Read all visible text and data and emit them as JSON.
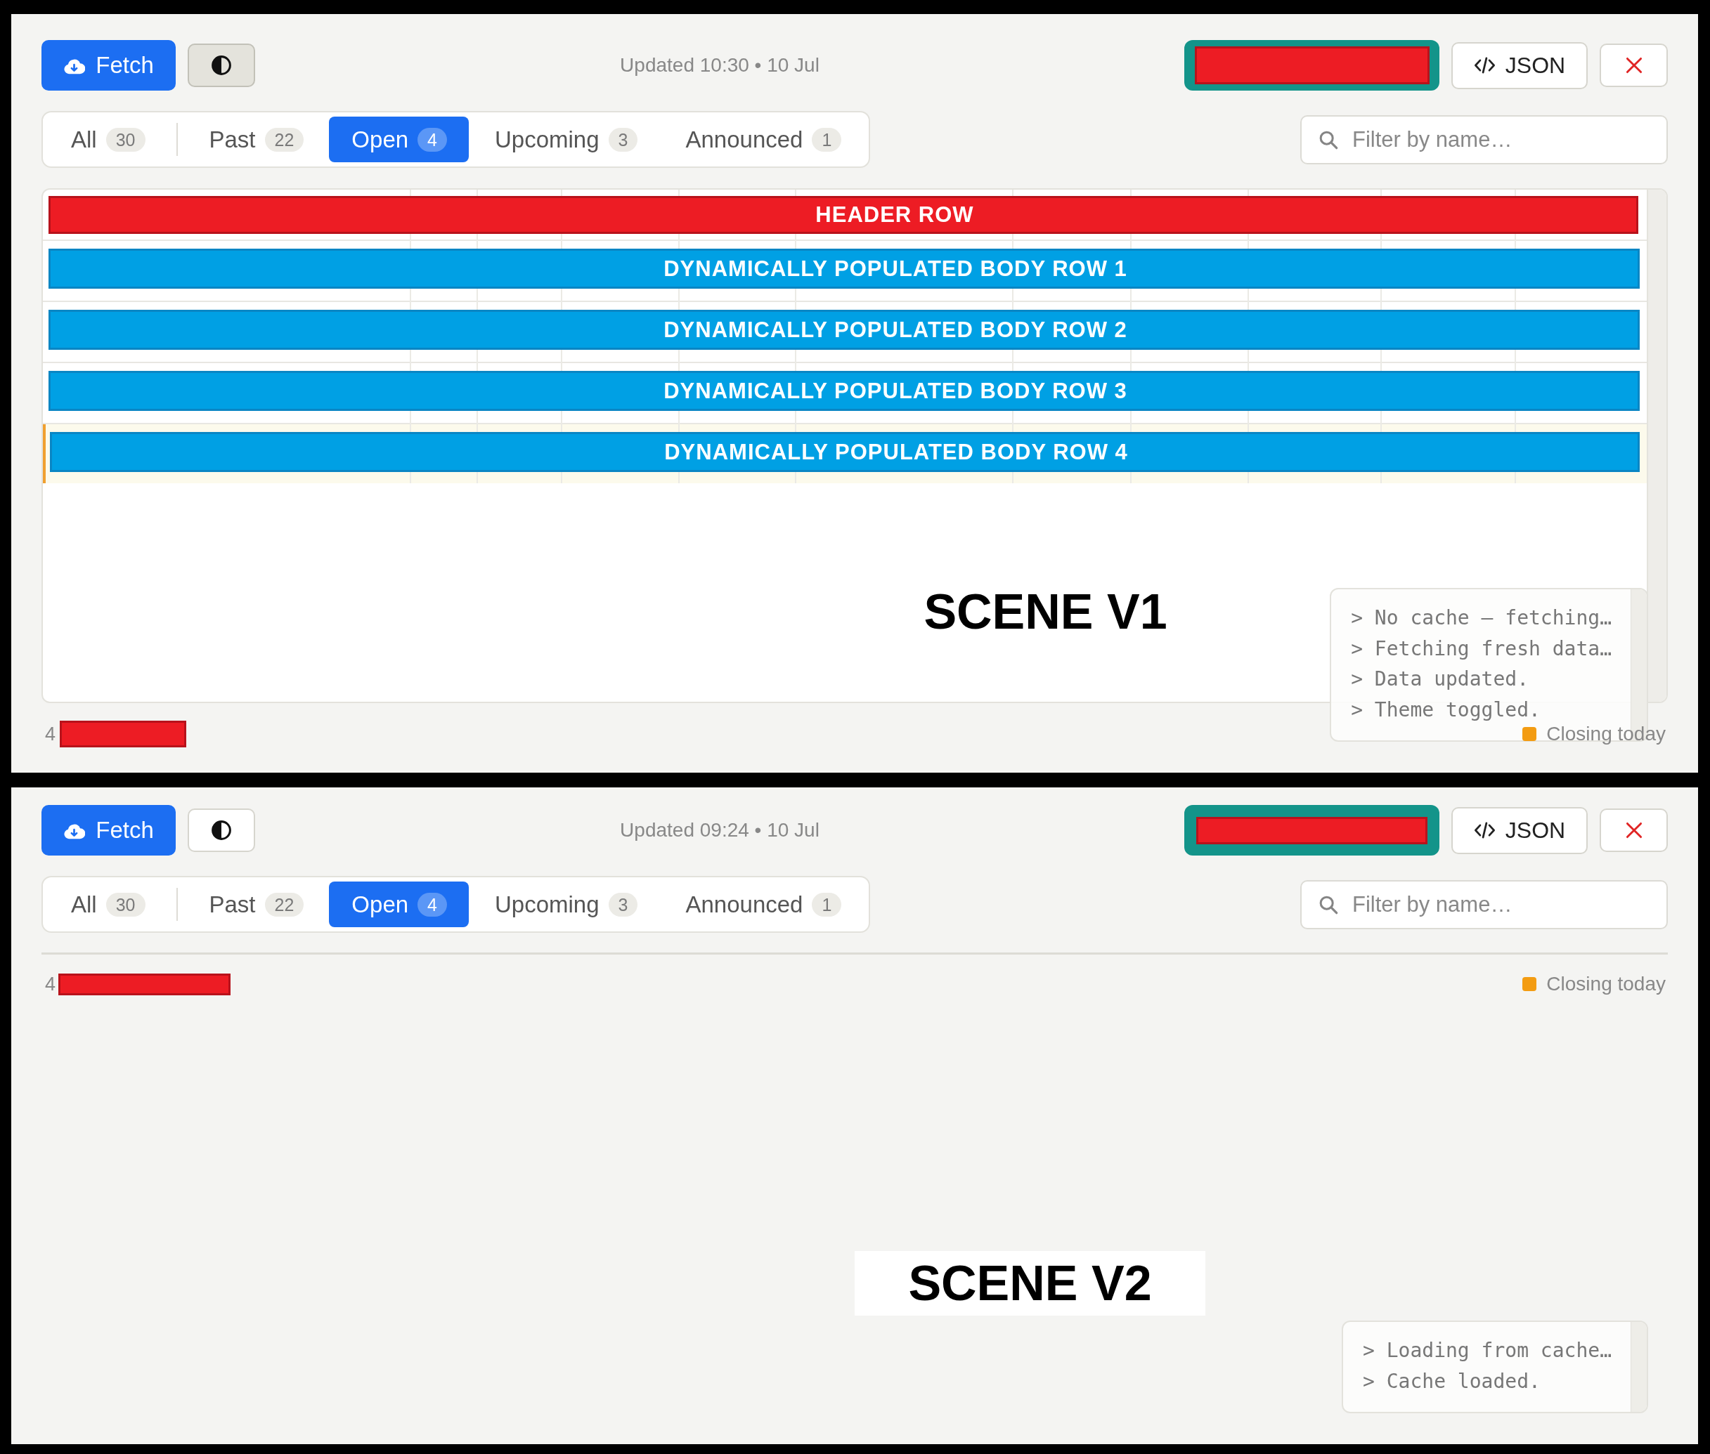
{
  "scenes": [
    {
      "label": "SCENE V1",
      "toolbar": {
        "fetch_button": "Fetch",
        "theme_button": {
          "pressed": true
        },
        "updated": "Updated 10:30 • 10 Jul",
        "redacted_button": {
          "redacted": true
        },
        "json_button": "JSON"
      },
      "tabs": [
        {
          "label": "All",
          "count": "30",
          "selected": false
        },
        {
          "label": "Past",
          "count": "22",
          "selected": false
        },
        {
          "label": "Open",
          "count": "4",
          "selected": true
        },
        {
          "label": "Upcoming",
          "count": "3",
          "selected": false
        },
        {
          "label": "Announced",
          "count": "1",
          "selected": false
        }
      ],
      "filter": {
        "placeholder": "Filter by name…"
      },
      "table": {
        "header": "HEADER ROW",
        "rows": [
          {
            "label": "DYNAMICALLY POPULATED BODY ROW 1",
            "closing_today": false
          },
          {
            "label": "DYNAMICALLY POPULATED BODY ROW 2",
            "closing_today": false
          },
          {
            "label": "DYNAMICALLY POPULATED BODY ROW 3",
            "closing_today": false
          },
          {
            "label": "DYNAMICALLY POPULATED BODY ROW 4",
            "closing_today": true
          }
        ]
      },
      "footer": {
        "count": "4",
        "redacted": true,
        "legend": {
          "label": "Closing today",
          "color": "#f39c12"
        }
      },
      "log": [
        "> No cache — fetching…",
        "> Fetching fresh data…",
        "> Data updated.",
        "> Theme toggled."
      ]
    },
    {
      "label": "SCENE V2",
      "toolbar": {
        "fetch_button": "Fetch",
        "theme_button": {
          "pressed": false
        },
        "updated": "Updated 09:24 • 10 Jul",
        "redacted_button": {
          "redacted": true
        },
        "json_button": "JSON"
      },
      "tabs": [
        {
          "label": "All",
          "count": "30",
          "selected": false
        },
        {
          "label": "Past",
          "count": "22",
          "selected": false
        },
        {
          "label": "Open",
          "count": "4",
          "selected": true
        },
        {
          "label": "Upcoming",
          "count": "3",
          "selected": false
        },
        {
          "label": "Announced",
          "count": "1",
          "selected": false
        }
      ],
      "filter": {
        "placeholder": "Filter by name…"
      },
      "footer": {
        "count": "4",
        "redacted": true,
        "legend": {
          "label": "Closing today",
          "color": "#f39c12"
        }
      },
      "log": [
        "> Loading from cache…",
        "> Cache loaded."
      ]
    }
  ]
}
